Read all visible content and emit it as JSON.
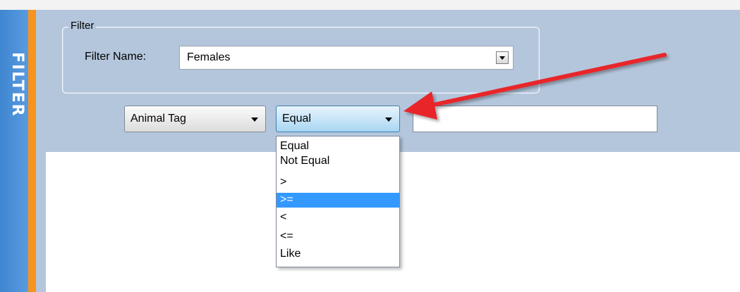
{
  "side_tab": {
    "label": "FILTER"
  },
  "groupbox": {
    "title": "Filter"
  },
  "filter_name": {
    "label": "Filter Name:",
    "value": "Females"
  },
  "criteria": {
    "field_value": "Animal Tag",
    "operator_value": "Equal",
    "value_text": ""
  },
  "operator_options": [
    {
      "label": "Equal",
      "selected": false
    },
    {
      "label": "Not Equal",
      "selected": false
    },
    {
      "label": ">",
      "selected": false
    },
    {
      "label": ">=",
      "selected": true
    },
    {
      "label": "<",
      "selected": false
    },
    {
      "label": "<=",
      "selected": false
    },
    {
      "label": "Like",
      "selected": false
    }
  ],
  "colors": {
    "panel_bg": "#b4c6dc",
    "accent_orange": "#f7931e",
    "side_tab_blue": "#4a8fd8",
    "highlight": "#3399ff",
    "annotation_arrow": "#e8252a"
  },
  "icons": {
    "dropdown": "chevron-down-icon",
    "annotation": "red-arrow-icon"
  }
}
